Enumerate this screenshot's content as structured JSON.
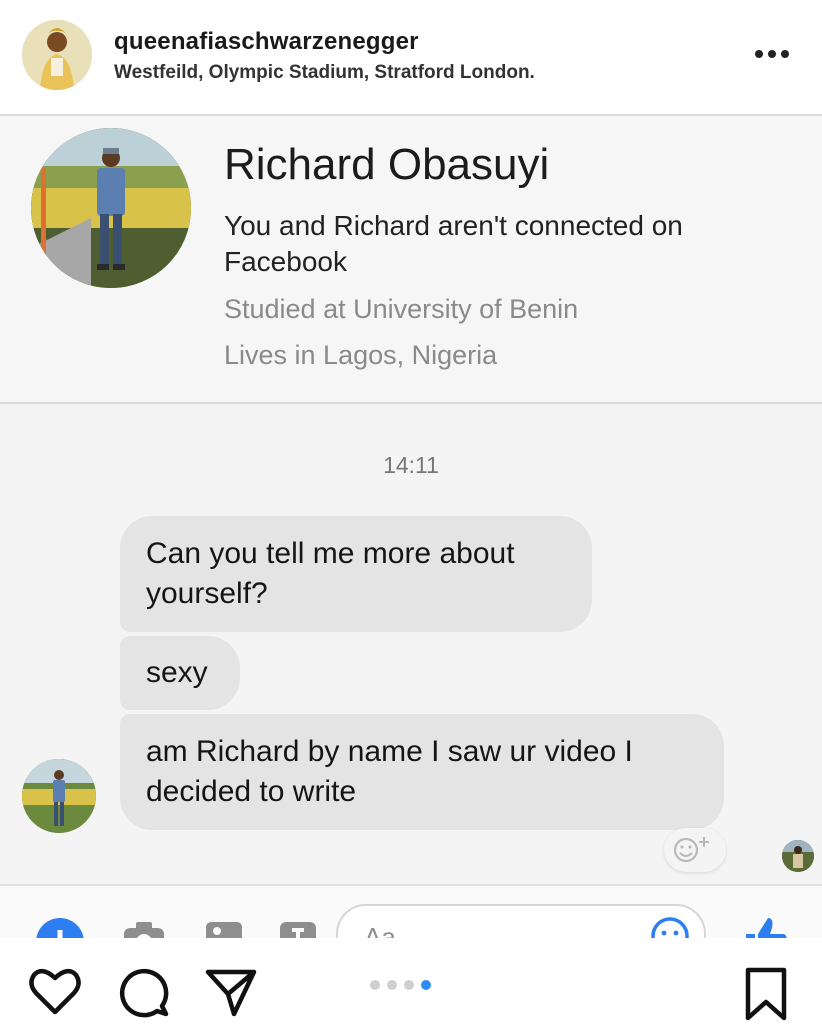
{
  "post": {
    "username": "queenafiaschwarzenegger",
    "location": "Westfeild, Olympic Stadium, Stratford London."
  },
  "profile": {
    "name": "Richard Obasuyi",
    "connection": "You and Richard aren't connected on Facebook",
    "studied": "Studied at University of Benin",
    "lives": "Lives in Lagos, Nigeria"
  },
  "chat": {
    "timestamp": "14:11",
    "messages": [
      {
        "text": "Can you tell me more about yourself?"
      },
      {
        "text": "sexy"
      },
      {
        "text": "am Richard by name I saw ur video I decided to write"
      }
    ],
    "composer_placeholder": "Aa"
  },
  "carousel": {
    "count": 4,
    "active_index": 3
  },
  "icons": {
    "more": "more-options-icon",
    "react": "add-reaction-icon",
    "plus": "plus-icon",
    "camera": "camera-icon",
    "gallery": "gallery-icon",
    "mic": "mic-icon",
    "emoji": "emoji-icon",
    "like": "thumbs-up-icon",
    "heart": "heart-icon",
    "comment": "comment-icon",
    "share": "share-icon",
    "save": "bookmark-icon"
  },
  "colors": {
    "messenger_blue": "#2d7ef0",
    "bubble": "#e4e4e4",
    "carousel_active": "#2d8cf0"
  }
}
